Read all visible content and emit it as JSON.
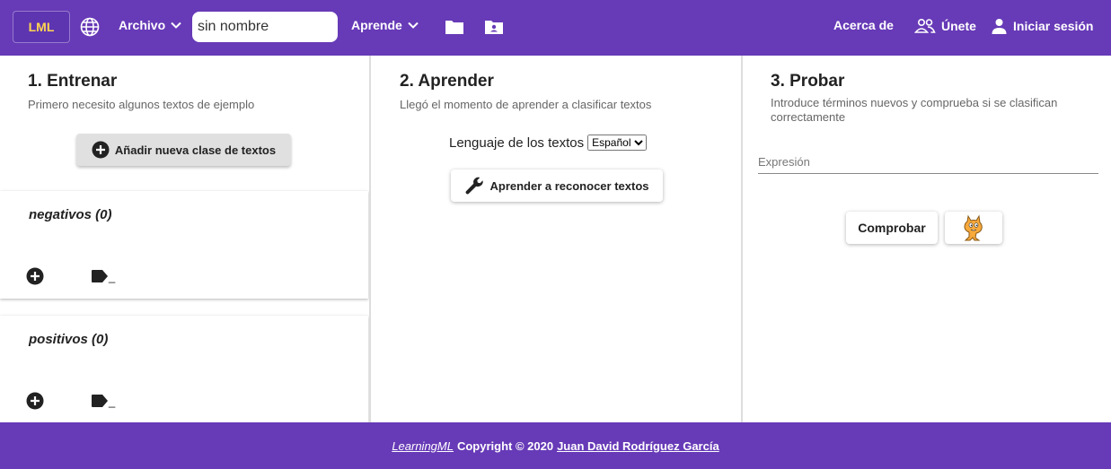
{
  "header": {
    "logo": "LML",
    "archivo_label": "Archivo",
    "project_name": "sin nombre",
    "aprende_label": "Aprende",
    "about_label": "Acerca de",
    "join_label": "Únete",
    "login_label": "Iniciar sesión",
    "colors": {
      "bar": "#673ab7",
      "logo_text": "#ffd54f"
    }
  },
  "train": {
    "title": "1. Entrenar",
    "subtitle": "Primero necesito algunos textos de ejemplo",
    "add_class_label": "Añadir nueva clase de textos",
    "classes": [
      {
        "name": "negativos (0)",
        "tag_text": "_"
      },
      {
        "name": "positivos (0)",
        "tag_text": "_"
      }
    ]
  },
  "learn": {
    "title": "2. Aprender",
    "subtitle": "Llegó el momento de aprender a clasificar textos",
    "language_label": "Lenguaje de los textos",
    "language_value": "Español",
    "learn_button": "Aprender a reconocer textos"
  },
  "test": {
    "title": "3. Probar",
    "subtitle": "Introduce términos nuevos y comprueba si se clasifican correctamente",
    "expression_placeholder": "Expresión",
    "check_button": "Comprobar"
  },
  "footer": {
    "brand": "LearningML",
    "copyright": "Copyright © 2020",
    "author": "Juan David Rodríguez García"
  }
}
